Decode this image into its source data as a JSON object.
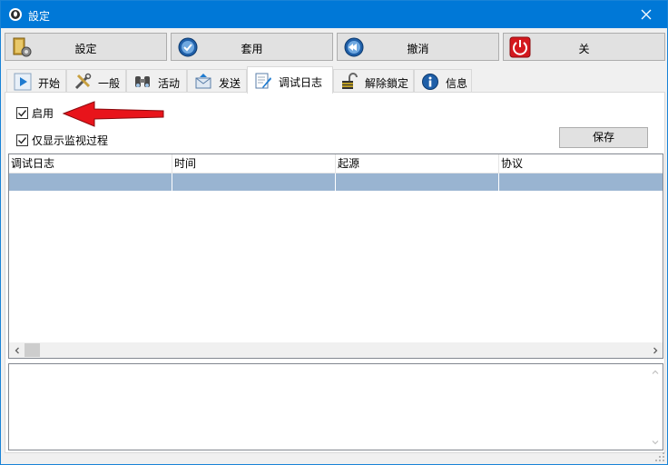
{
  "window": {
    "title": "設定"
  },
  "toolbar": {
    "buttons": [
      {
        "label": "設定",
        "icon": "settings-icon"
      },
      {
        "label": "套用",
        "icon": "apply-icon"
      },
      {
        "label": "撤消",
        "icon": "undo-icon"
      },
      {
        "label": "关",
        "icon": "power-icon"
      }
    ]
  },
  "tabs": [
    {
      "label": "开始",
      "icon": "play-icon"
    },
    {
      "label": "一般",
      "icon": "tools-icon"
    },
    {
      "label": "活动",
      "icon": "binoculars-icon"
    },
    {
      "label": "发送",
      "icon": "send-icon"
    },
    {
      "label": "调试日志",
      "icon": "notepad-pen-icon",
      "active": true
    },
    {
      "label": "解除鎖定",
      "icon": "unlock-icon"
    },
    {
      "label": "信息",
      "icon": "info-icon"
    }
  ],
  "options": {
    "enable_label": "启用",
    "enable_checked": true,
    "monitor_label": "仅显示监视过程",
    "monitor_checked": true
  },
  "save_label": "保存",
  "grid": {
    "columns": [
      "调试日志",
      "时间",
      "起源",
      "协议"
    ]
  },
  "colors": {
    "titlebar": "#0078d7",
    "selection": "#99b4d1",
    "arrow": "#e8141b"
  }
}
